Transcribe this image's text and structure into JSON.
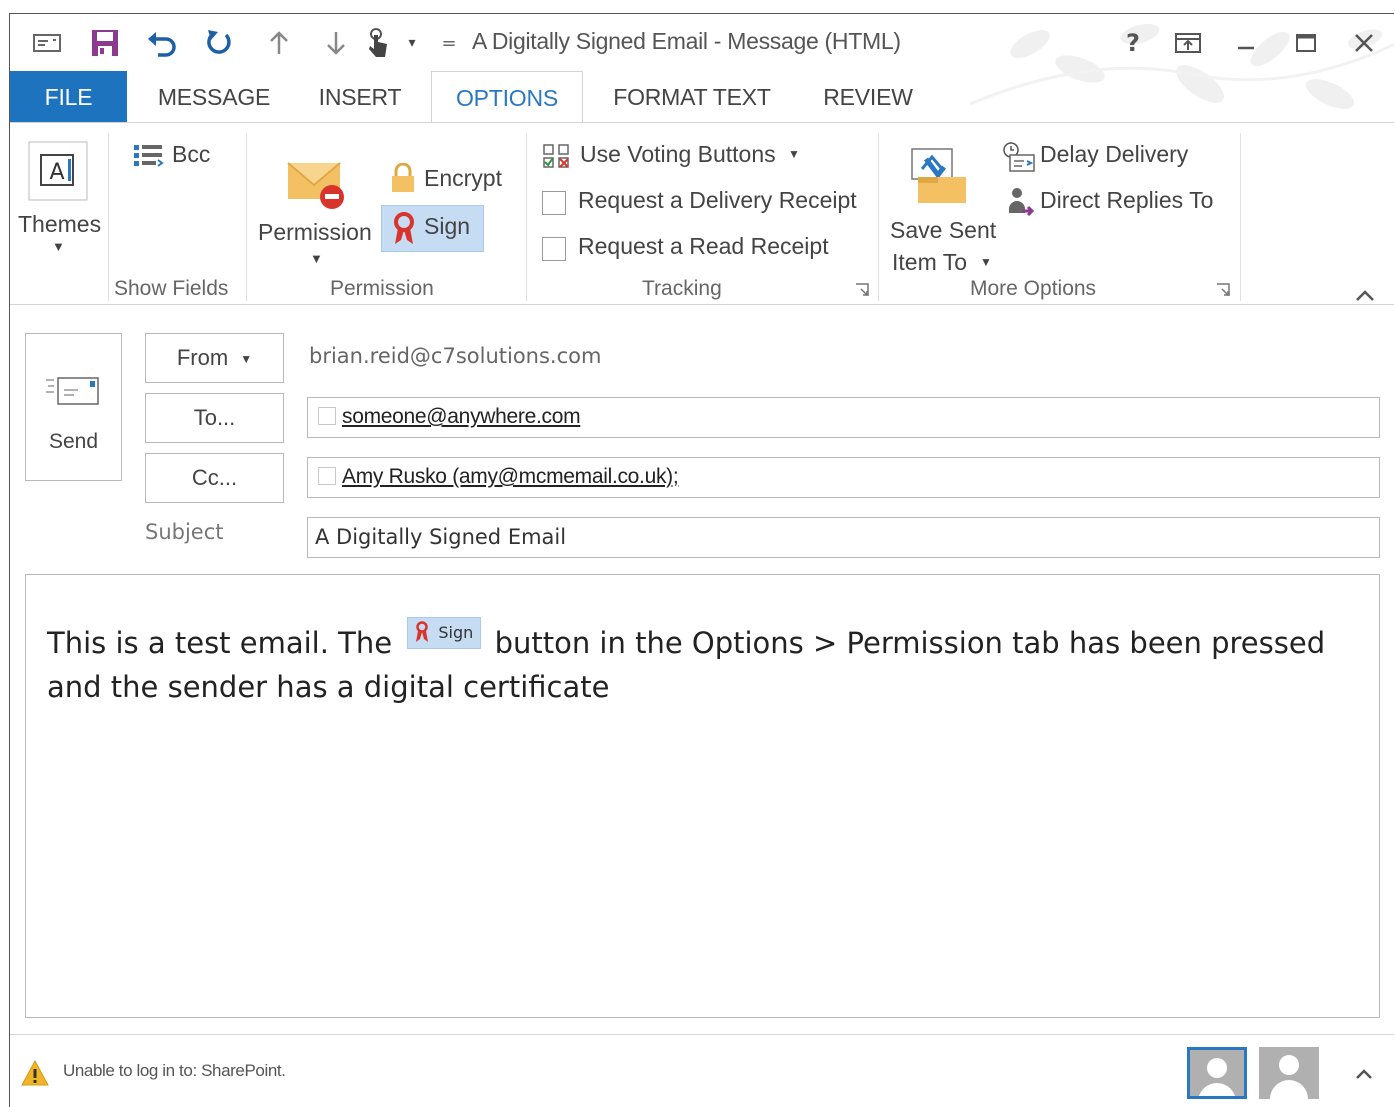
{
  "window": {
    "title": "A Digitally Signed Email - Message (HTML)",
    "help": "?",
    "qat_customize": "="
  },
  "tabs": [
    "FILE",
    "MESSAGE",
    "INSERT",
    "OPTIONS",
    "FORMAT TEXT",
    "REVIEW"
  ],
  "active_tab": "OPTIONS",
  "ribbon": {
    "themes": {
      "label": "Themes"
    },
    "show_fields": {
      "bcc": "Bcc",
      "group": "Show Fields"
    },
    "permission": {
      "permission": "Permission",
      "encrypt": "Encrypt",
      "sign": "Sign",
      "group": "Permission"
    },
    "tracking": {
      "voting": "Use Voting Buttons",
      "delivery_receipt": "Request a Delivery Receipt",
      "read_receipt": "Request a Read Receipt",
      "group": "Tracking"
    },
    "more_options": {
      "save_sent_1": "Save Sent",
      "save_sent_2": "Item To",
      "delay": "Delay Delivery",
      "direct_replies": "Direct Replies To",
      "group": "More Options"
    }
  },
  "compose": {
    "send": "Send",
    "from_btn": "From",
    "from_value": "brian.reid@c7solutions.com",
    "to_btn": "To...",
    "to_value": "someone@anywhere.com",
    "cc_btn": "Cc...",
    "cc_value": "Amy Rusko (amy@mcmemail.co.uk);",
    "subject_label": "Subject",
    "subject_value": "A Digitally Signed Email"
  },
  "body": {
    "part1": "This is a test email. The",
    "inline_sign": "Sign",
    "part2": "button in the Options > Permission tab has been pressed and the sender has a digital certificate"
  },
  "status": {
    "message": "Unable to log in to: SharePoint."
  },
  "colors": {
    "accent": "#1e73be",
    "sign_highlight": "#c5dcf3",
    "ribbon_icon_red": "#d9342b"
  }
}
